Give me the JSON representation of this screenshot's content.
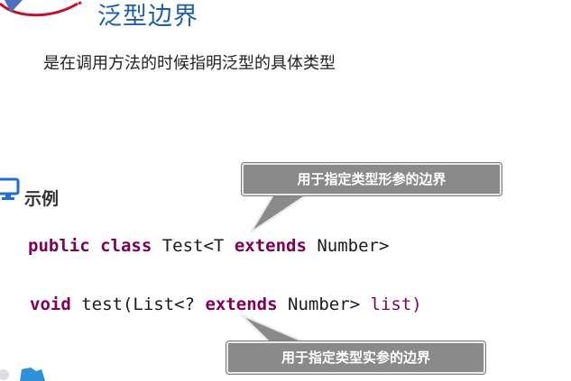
{
  "header": {
    "title": "泛型边界"
  },
  "intro": {
    "text": "是在调用方法的时候指明泛型的具体类型"
  },
  "section": {
    "label": "示例"
  },
  "code": {
    "line1": {
      "kw1": "public",
      "kw2": "class",
      "pre": " Test<T ",
      "kw3": "extends",
      "post": " Number>"
    },
    "line2": {
      "kw1": "void",
      "pre": " test(List<? ",
      "kw2": "extends",
      "post": " Number> ",
      "tail": "list)"
    }
  },
  "callouts": {
    "upper": "用于指定类型形参的边界",
    "lower": "用于指定类型实参的边界"
  },
  "colors": {
    "title": "#1f5fa8",
    "keyword": "#7f0055",
    "callout_bg": "#8a8a8a"
  },
  "icons": {
    "logo": "logo-swoosh-icon",
    "section": "monitor-icon"
  }
}
